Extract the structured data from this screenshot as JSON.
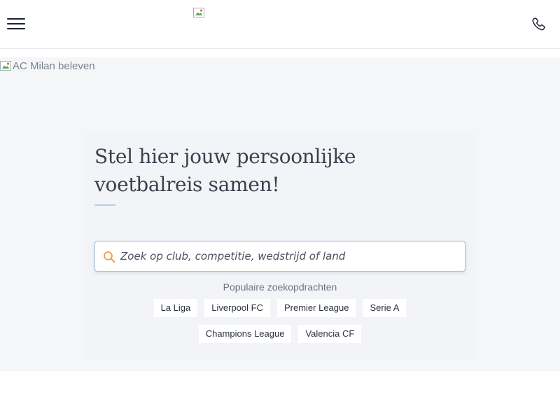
{
  "header": {
    "menu_icon": "hamburger-menu-icon",
    "logo_icon": "broken-image-icon",
    "phone_icon": "phone-icon"
  },
  "hero": {
    "image_alt": "AC Milan beleven",
    "headline": "Stel hier jouw persoonlijke voetbalreis samen!",
    "search": {
      "placeholder": "Zoek op club, competitie, wedstrijd of land",
      "value": "",
      "icon": "search-icon"
    },
    "popular": {
      "title": "Populaire zoekopdrachten",
      "items": [
        {
          "label": "La Liga"
        },
        {
          "label": "Liverpool FC"
        },
        {
          "label": "Premier League"
        },
        {
          "label": "Serie A"
        },
        {
          "label": "Champions League"
        },
        {
          "label": "Valencia CF"
        }
      ]
    }
  },
  "colors": {
    "accent_orange": "#f0932b",
    "search_border": "#9dbde6",
    "hero_background": "#f5f6f8",
    "text_dark": "#1c2430"
  }
}
